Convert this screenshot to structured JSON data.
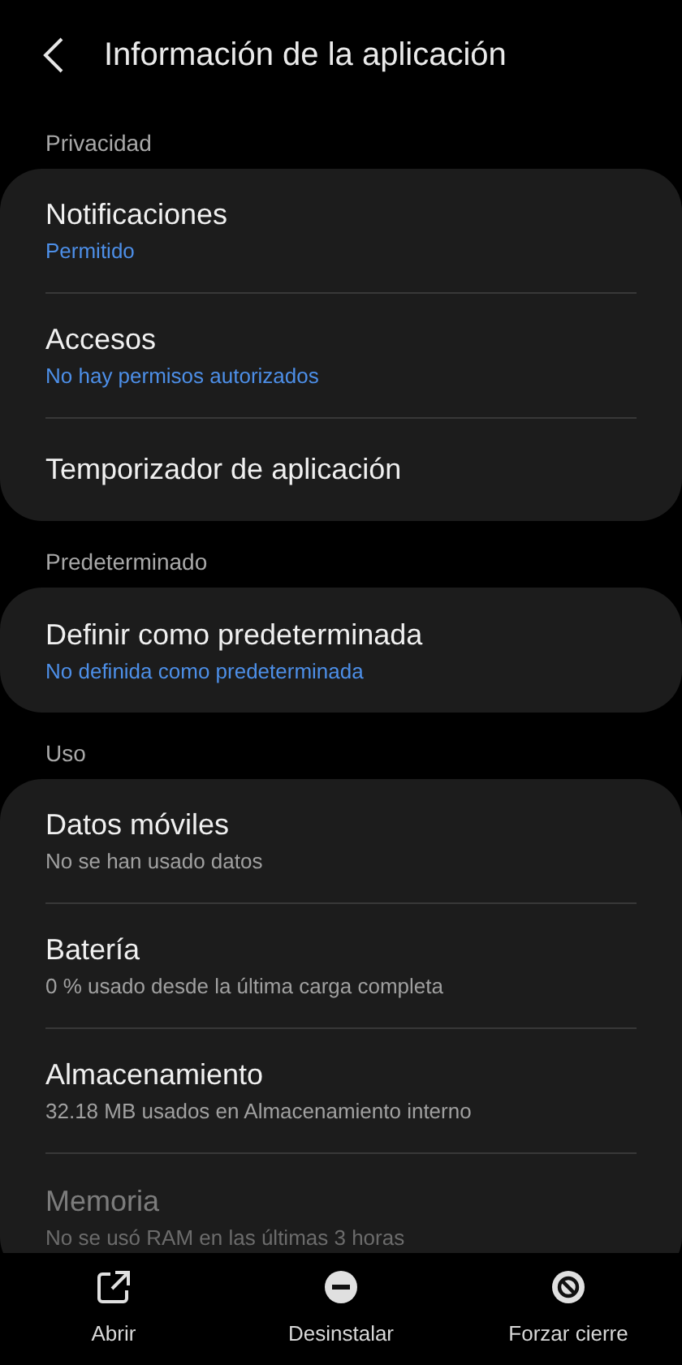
{
  "header": {
    "title": "Información de la aplicación"
  },
  "sections": [
    {
      "label": "Privacidad",
      "items": [
        {
          "title": "Notificaciones",
          "summary": "Permitido",
          "accent": true
        },
        {
          "title": "Accesos",
          "summary": "No hay permisos autorizados",
          "accent": true
        },
        {
          "title": "Temporizador de aplicación"
        }
      ]
    },
    {
      "label": "Predeterminado",
      "items": [
        {
          "title": "Definir como predeterminada",
          "summary": "No definida como predeterminada",
          "accent": true
        }
      ]
    },
    {
      "label": "Uso",
      "items": [
        {
          "title": "Datos móviles",
          "summary": "No se han usado datos",
          "accent": false
        },
        {
          "title": "Batería",
          "summary": "0 % usado desde la última carga completa",
          "accent": false
        },
        {
          "title": "Almacenamiento",
          "summary": "32.18 MB usados en Almacenamiento interno",
          "accent": false
        },
        {
          "title": "Memoria",
          "summary": "No se usó RAM en las últimas 3 horas",
          "accent": false
        }
      ]
    }
  ],
  "actions": [
    {
      "kind": "open",
      "label": "Abrir"
    },
    {
      "kind": "uninstall",
      "label": "Desinstalar"
    },
    {
      "kind": "force-stop",
      "label": "Forzar cierre"
    }
  ]
}
